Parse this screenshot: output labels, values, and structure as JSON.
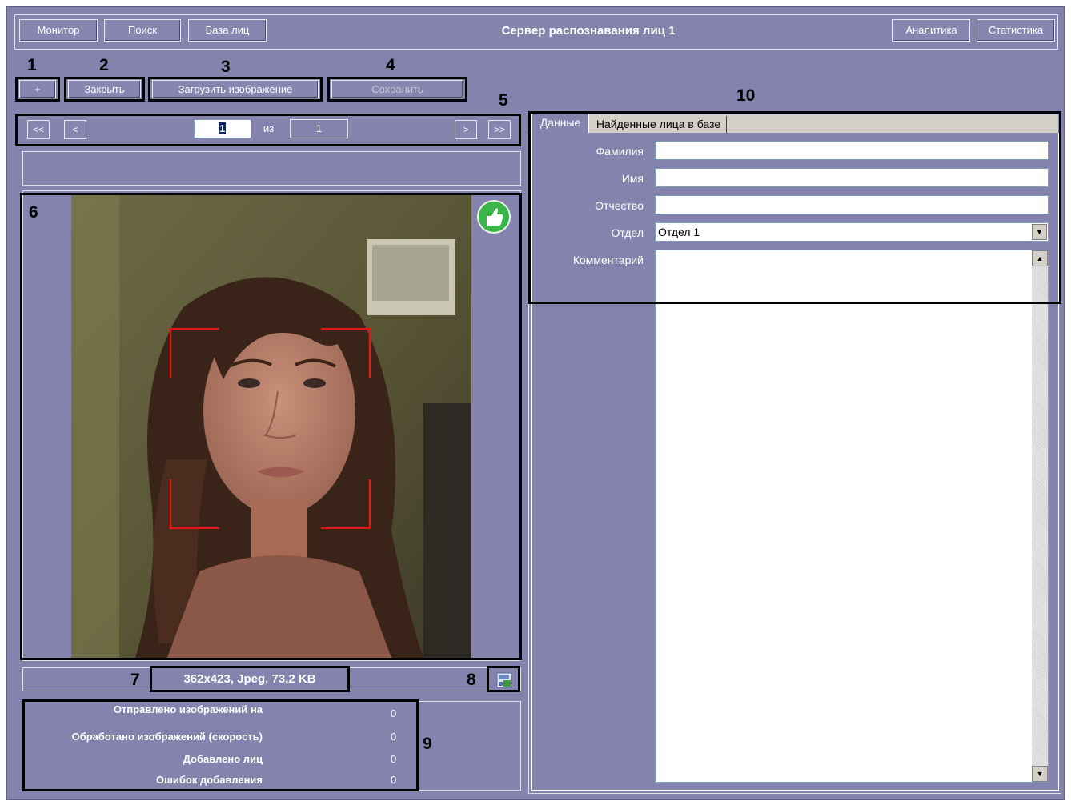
{
  "window": {
    "title": "Сервер распознавания лиц 1"
  },
  "topnav": {
    "monitor": "Монитор",
    "search": "Поиск",
    "face_base": "База лиц",
    "analytics": "Аналитика",
    "statistics": "Статистика"
  },
  "callouts": [
    "1",
    "2",
    "3",
    "4",
    "5",
    "6",
    "7",
    "8",
    "9",
    "10"
  ],
  "toolbar": {
    "add": "+",
    "close": "Закрыть",
    "load_image": "Загрузить изображение",
    "save": "Сохранить"
  },
  "pager": {
    "first": "<<",
    "prev": "<",
    "next": ">",
    "last": ">>",
    "current": "1",
    "of_label": "из",
    "total": "1"
  },
  "image": {
    "info": "362x423, Jpeg, 73,2 KB",
    "quality_icon": "thumbs-up-icon",
    "export_icon": "save-icon"
  },
  "stats": {
    "rows": [
      {
        "label": "Отправлено изображений на",
        "value": "0"
      },
      {
        "label": "Обработано изображений (скорость)",
        "value": "0"
      },
      {
        "label": "Добавлено лиц",
        "value": "0"
      },
      {
        "label": "Ошибок добавления",
        "value": "0"
      }
    ]
  },
  "tabs": {
    "data": "Данные",
    "found": "Найденные лица в базе"
  },
  "form": {
    "surname_label": "Фамилия",
    "surname_value": "",
    "name_label": "Имя",
    "name_value": "",
    "patronymic_label": "Отчество",
    "patronymic_value": "",
    "dept_label": "Отдел",
    "dept_value": "Отдел 1",
    "comment_label": "Комментарий",
    "comment_value": ""
  },
  "colors": {
    "panel_bg": "#8383ad",
    "highlight_border": "#000000",
    "face_box": "#e01818",
    "thumb_icon": "#39b54a"
  }
}
